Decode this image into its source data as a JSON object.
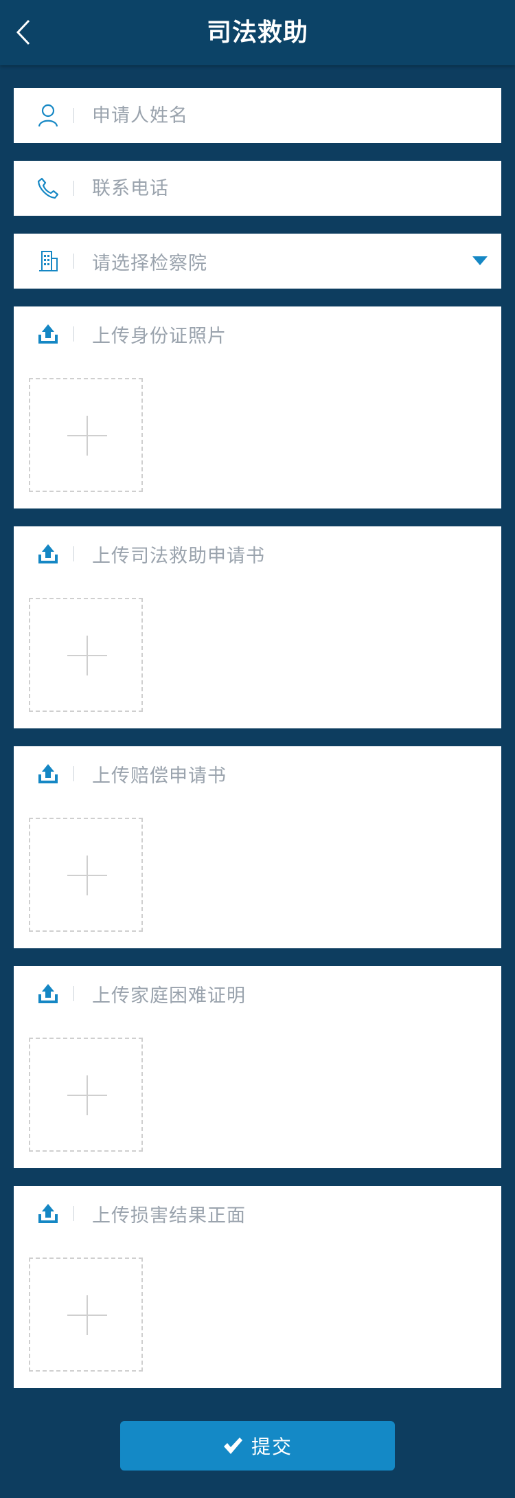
{
  "header": {
    "title": "司法救助",
    "back_icon": "chevron-left-icon"
  },
  "form": {
    "name": {
      "placeholder": "申请人姓名",
      "icon": "user-icon"
    },
    "phone": {
      "placeholder": "联系电话",
      "icon": "phone-icon"
    },
    "procuratorate": {
      "placeholder": "请选择检察院",
      "icon": "building-icon",
      "dropdown_icon": "caret-down-icon"
    }
  },
  "uploads": [
    {
      "label": "上传身份证照片",
      "icon": "upload-icon"
    },
    {
      "label": "上传司法救助申请书",
      "icon": "upload-icon"
    },
    {
      "label": "上传赔偿申请书",
      "icon": "upload-icon"
    },
    {
      "label": "上传家庭困难证明",
      "icon": "upload-icon"
    },
    {
      "label": "上传损害结果正面",
      "icon": "upload-icon"
    }
  ],
  "submit": {
    "label": "提交",
    "icon": "check-icon"
  },
  "colors": {
    "background": "#0d3d5f",
    "header": "#0c4367",
    "accent": "#1489c6",
    "placeholder": "#9aa3ad"
  }
}
